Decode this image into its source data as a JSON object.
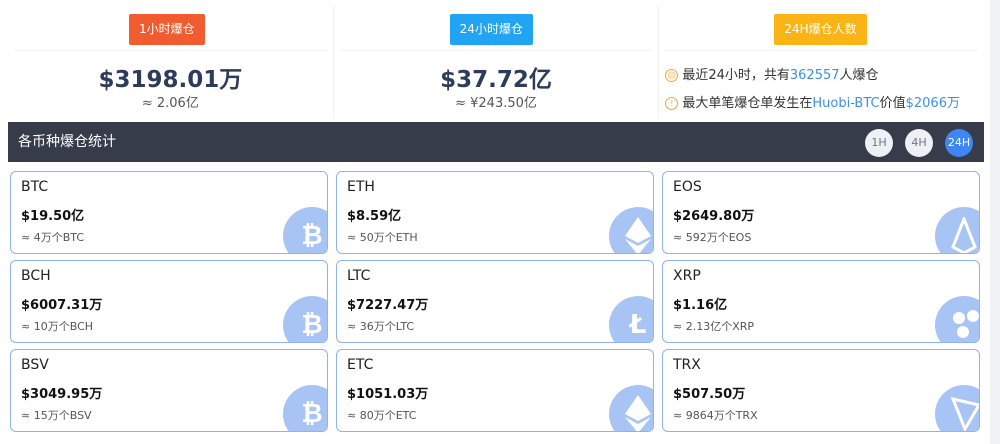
{
  "stats": [
    {
      "badge": "1小时爆仓",
      "amount": "$3198.01万",
      "sub": "≈ 2.06亿",
      "color": "#f05b2f"
    },
    {
      "badge": "24小时爆仓",
      "amount": "$37.72亿",
      "sub": "≈ ¥243.50亿",
      "color": "#22a4f5"
    },
    {
      "badge": "24H爆仓人数",
      "color": "#fbb416",
      "line1": {
        "pre": "最近24小时，共有",
        "num": "362557",
        "post": "人爆仓"
      },
      "line2": {
        "pre": "最大单笔爆仓单发生在",
        "place": "Huobi-BTC",
        "mid": "价值",
        "value": "$2066万"
      }
    }
  ],
  "bar": {
    "title": "各币种爆仓统计",
    "buttons": [
      "1H",
      "4H",
      "24H"
    ],
    "active": "24H"
  },
  "coins": [
    {
      "symbol": "BTC",
      "value": "$19.50亿",
      "approx": "≈ 4万个BTC",
      "icon": "bitcoin-icon"
    },
    {
      "symbol": "ETH",
      "value": "$8.59亿",
      "approx": "≈ 50万个ETH",
      "icon": "ethereum-icon"
    },
    {
      "symbol": "EOS",
      "value": "$2649.80万",
      "approx": "≈ 592万个EOS",
      "icon": "eos-icon"
    },
    {
      "symbol": "BCH",
      "value": "$6007.31万",
      "approx": "≈ 10万个BCH",
      "icon": "bitcoin-cash-icon"
    },
    {
      "symbol": "LTC",
      "value": "$7227.47万",
      "approx": "≈ 36万个LTC",
      "icon": "litecoin-icon"
    },
    {
      "symbol": "XRP",
      "value": "$1.16亿",
      "approx": "≈ 2.13亿个XRP",
      "icon": "ripple-icon"
    },
    {
      "symbol": "BSV",
      "value": "$3049.95万",
      "approx": "≈ 15万个BSV",
      "icon": "bitcoin-sv-icon"
    },
    {
      "symbol": "ETC",
      "value": "$1051.03万",
      "approx": "≈ 80万个ETC",
      "icon": "ethereum-classic-icon"
    },
    {
      "symbol": "TRX",
      "value": "$507.50万",
      "approx": "≈ 9864万个TRX",
      "icon": "tron-icon"
    }
  ]
}
